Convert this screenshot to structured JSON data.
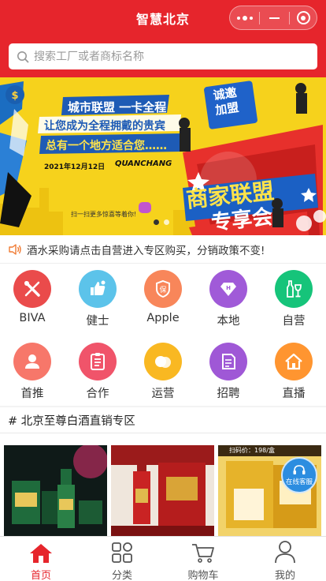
{
  "header": {
    "title": "智慧北京"
  },
  "search": {
    "placeholder": "搜索工厂或者商标名称"
  },
  "banner": {
    "left_lines": [
      "城市联盟 一卡全程",
      "让您成为全程拥戴的贵宾",
      "总有一个地方适合您……"
    ],
    "date_text": "2021年12月12日",
    "city_text": "QUANCHANG",
    "scan_text": "扫一扫更多惊喜等着你!",
    "badge_text": [
      "诚邀",
      "加盟"
    ],
    "headline": "商家联盟",
    "subheadline": "专享会",
    "slides_total": 2,
    "active_slide": 0
  },
  "notice": {
    "text": "酒水采购请点击自营进入专区购买，分销政策不变!"
  },
  "grid": {
    "items": [
      {
        "label": "BIVA",
        "color": "#ea4b4b",
        "icon": "tools-icon"
      },
      {
        "label": "健士",
        "color": "#5cc3ea",
        "icon": "thumbs-up-icon"
      },
      {
        "label": "Apple",
        "color": "#f8865a",
        "icon": "shield-icon"
      },
      {
        "label": "本地",
        "color": "#a05ad8",
        "icon": "diamond-icon"
      },
      {
        "label": "自营",
        "color": "#16c47a",
        "icon": "bottle-icon"
      },
      {
        "label": "首推",
        "color": "#f7776a",
        "icon": "user-icon"
      },
      {
        "label": "合作",
        "color": "#f0546a",
        "icon": "clipboard-icon"
      },
      {
        "label": "运营",
        "color": "#f9b822",
        "icon": "chat-icon"
      },
      {
        "label": "招聘",
        "color": "#9f58d6",
        "icon": "document-icon"
      },
      {
        "label": "直播",
        "color": "#ff9530",
        "icon": "home-icon"
      }
    ]
  },
  "section": {
    "title": "# 北京至尊白酒直销专区"
  },
  "products": [
    {
      "label": ""
    },
    {
      "label": ""
    },
    {
      "label": "扫码价：198/盒"
    }
  ],
  "customer_service": {
    "label": "在线客服"
  },
  "tabbar": {
    "items": [
      {
        "label": "首页",
        "icon": "home-icon"
      },
      {
        "label": "分类",
        "icon": "category-grid-icon"
      },
      {
        "label": "购物车",
        "icon": "cart-icon"
      },
      {
        "label": "我的",
        "icon": "person-icon"
      }
    ],
    "active_color": "#e6252c"
  }
}
